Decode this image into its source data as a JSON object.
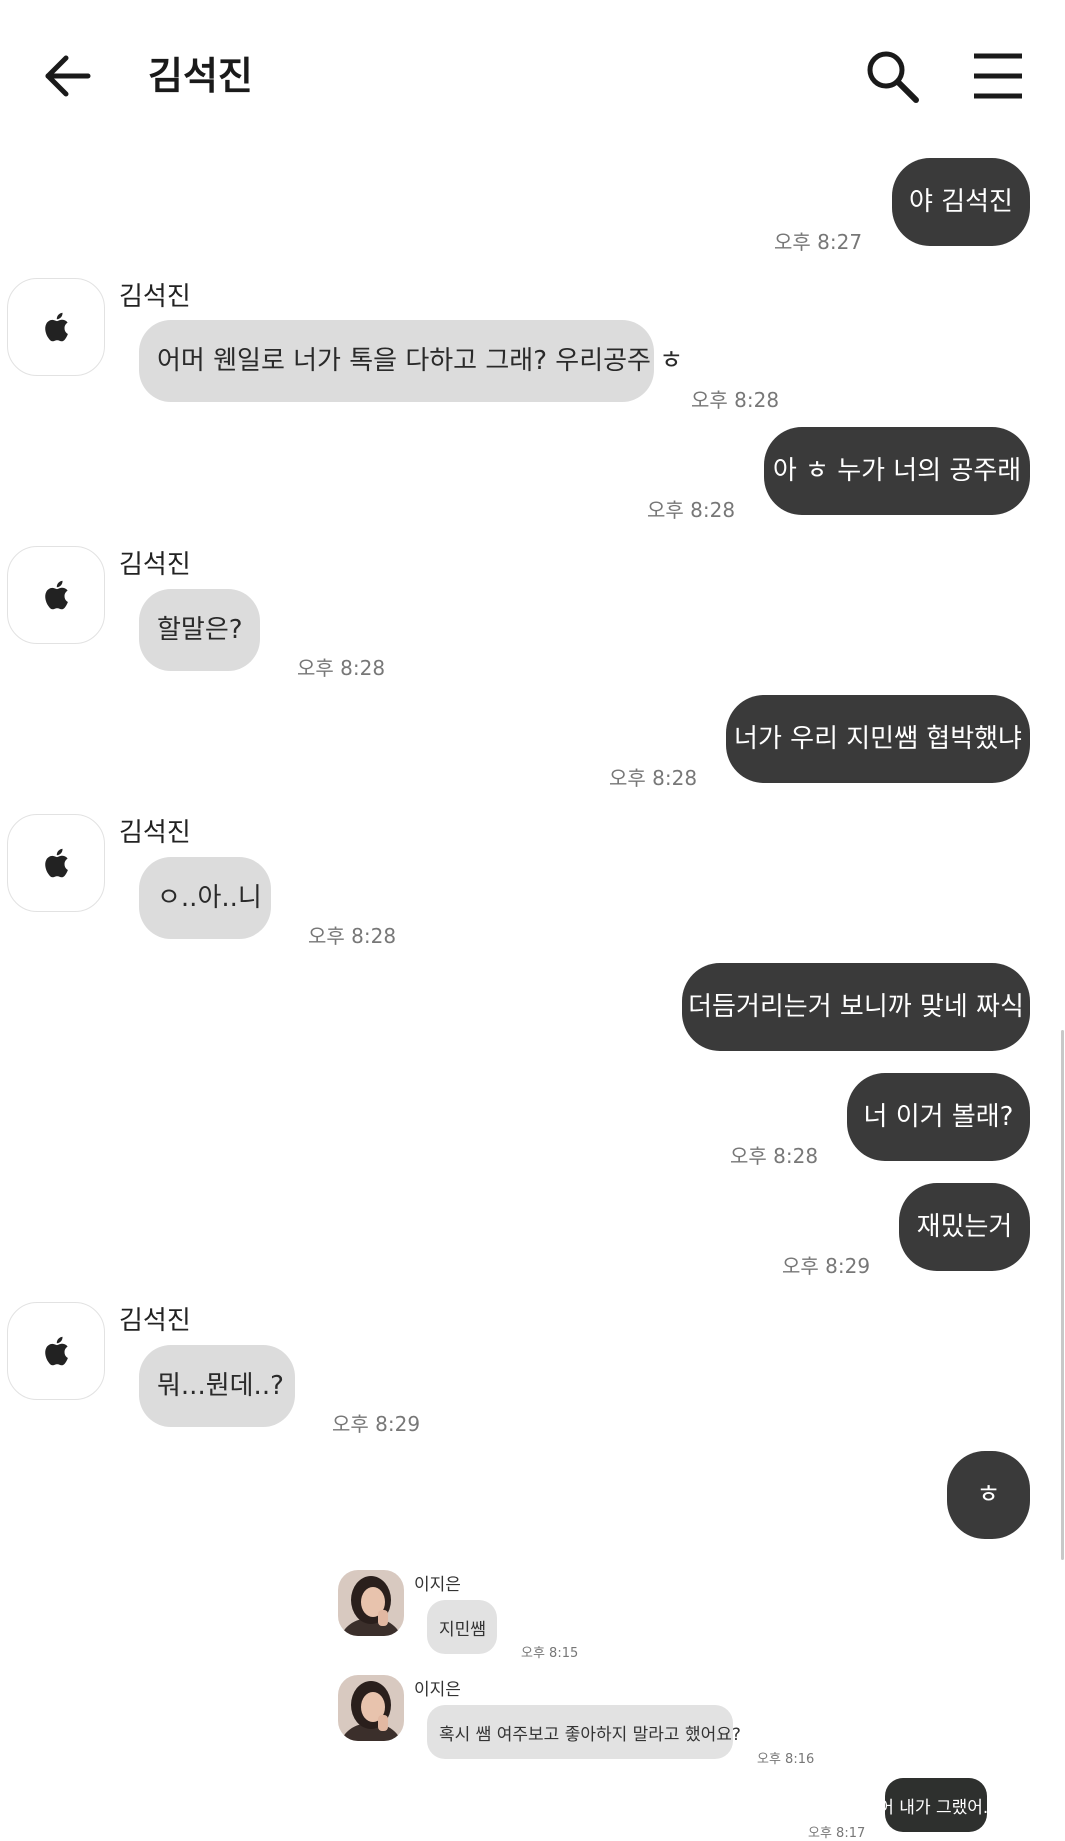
{
  "header": {
    "title": "김석진",
    "back_icon": "arrow-left-icon",
    "search_icon": "search-icon",
    "menu_icon": "hamburger-menu-icon"
  },
  "contact": {
    "name": "김석진",
    "avatar_icon": "apple-logo-icon"
  },
  "messages": [
    {
      "dir": "out",
      "text": "야 김석진",
      "time": "오후 8:27"
    },
    {
      "dir": "in",
      "sender": "김석진",
      "text": "어머 웬일로 너가 톡을 다하고 그래?  우리공주 ㅎ",
      "time": "오후 8:28"
    },
    {
      "dir": "out",
      "text": "아 ㅎ 누가 너의 공주래",
      "time": "오후 8:28"
    },
    {
      "dir": "in",
      "sender": "김석진",
      "text": "할말은?",
      "time": "오후 8:28"
    },
    {
      "dir": "out",
      "text": "너가 우리 지민쌤 협박했냐",
      "time": "오후 8:28"
    },
    {
      "dir": "in",
      "sender": "김석진",
      "text": "ㅇ..아..니",
      "time": "오후 8:28"
    },
    {
      "dir": "out",
      "text": "더듬거리는거 보니까 맞네 짜식",
      "time": ""
    },
    {
      "dir": "out",
      "text": "너 이거 볼래?",
      "time": "오후 8:28"
    },
    {
      "dir": "out",
      "text": "재밌는거",
      "time": "오후 8:29"
    },
    {
      "dir": "in",
      "sender": "김석진",
      "text": "뭐...뭔데..?",
      "time": "오후 8:29"
    },
    {
      "dir": "out",
      "text": "ㅎ",
      "time": ""
    }
  ],
  "shared_image": {
    "messages": [
      {
        "dir": "in",
        "sender": "이지은",
        "text": "지민쌤",
        "time": "오후 8:15"
      },
      {
        "dir": "in",
        "sender": "이지은",
        "text": "혹시 쌤 여주보고 좋아하지 말라고 했어요?",
        "time": "오후 8:16"
      },
      {
        "dir": "out",
        "text": "어 내가 그랬어..",
        "time": "오후 8:17"
      }
    ]
  },
  "colors": {
    "outgoing_bubble": "#3a3a3a",
    "incoming_bubble": "#dcdcdc",
    "background": "#ffffff"
  }
}
